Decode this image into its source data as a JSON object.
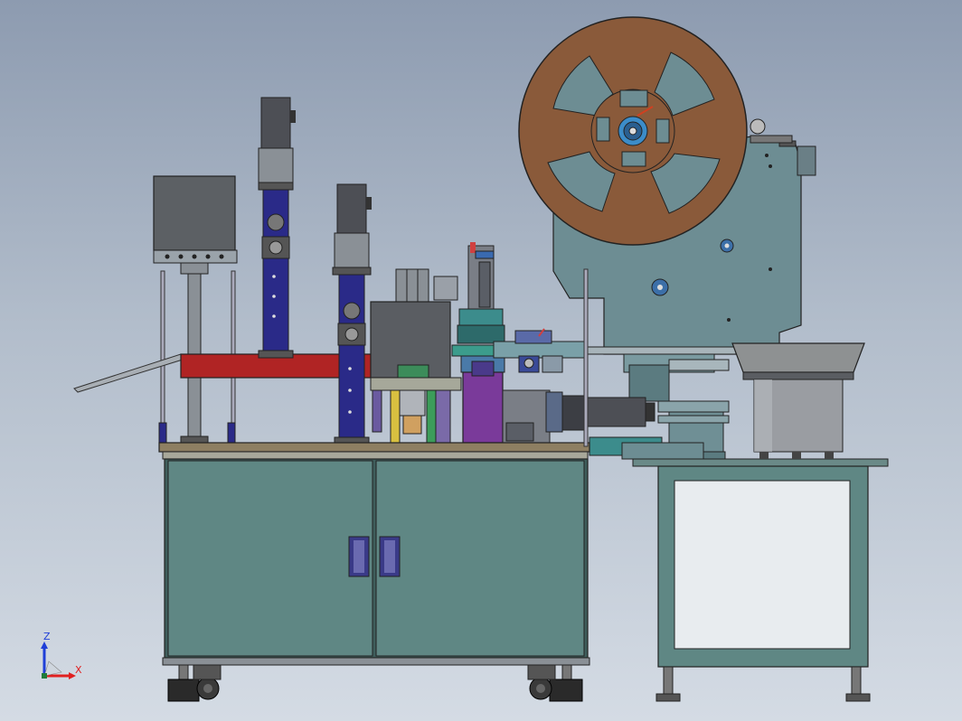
{
  "view": {
    "background_top": "#8d9bb0",
    "background_bottom": "#d4dbe4"
  },
  "triad": {
    "z_label": "Z",
    "x_label": "X",
    "z_color": "#1f3fd8",
    "x_color": "#e02020"
  },
  "colors": {
    "cabinet": "#5f8784",
    "cabinet_dark": "#3f5e5c",
    "reel": "#8a5a3a",
    "feeder_body": "#6d8d93",
    "motor": "#4d4f55",
    "slide_blue": "#2a2a88",
    "red_bar": "#b02424",
    "purple_block": "#7a3a9a",
    "bowl": "#8e9192",
    "worktop": "#8e7f62"
  }
}
